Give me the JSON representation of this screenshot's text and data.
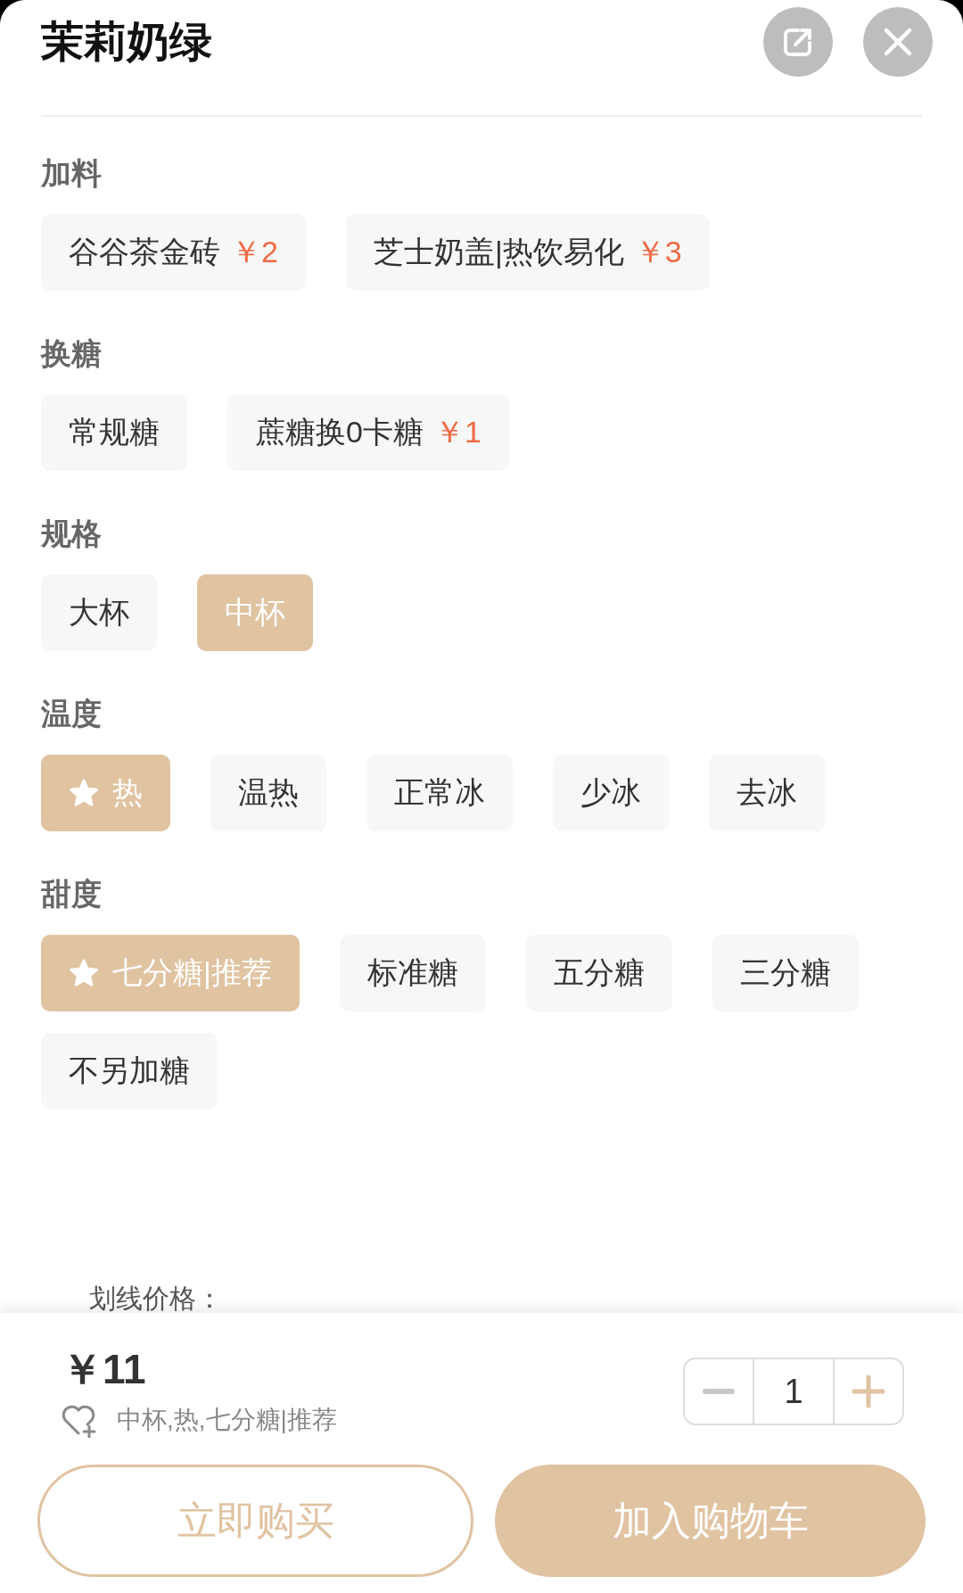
{
  "header": {
    "title": "茉莉奶绿"
  },
  "option_groups": [
    {
      "title": "加料",
      "options": [
        {
          "label": "谷谷茶金砖",
          "price": "￥2",
          "selected": false,
          "starred": false
        },
        {
          "label": "芝士奶盖|热饮易化",
          "price": "￥3",
          "selected": false,
          "starred": false
        }
      ]
    },
    {
      "title": "换糖",
      "options": [
        {
          "label": "常规糖",
          "selected": false,
          "starred": false
        },
        {
          "label": "蔗糖换0卡糖",
          "price": "￥1",
          "selected": false,
          "starred": false
        }
      ]
    },
    {
      "title": "规格",
      "options": [
        {
          "label": "大杯",
          "selected": false,
          "starred": false
        },
        {
          "label": "中杯",
          "selected": true,
          "starred": false
        }
      ]
    },
    {
      "title": "温度",
      "options": [
        {
          "label": "热",
          "selected": true,
          "starred": true
        },
        {
          "label": "温热",
          "selected": false,
          "starred": false
        },
        {
          "label": "正常冰",
          "selected": false,
          "starred": false
        },
        {
          "label": "少冰",
          "selected": false,
          "starred": false
        },
        {
          "label": "去冰",
          "selected": false,
          "starred": false
        }
      ]
    },
    {
      "title": "甜度",
      "options": [
        {
          "label": "七分糖|推荐",
          "selected": true,
          "starred": true
        },
        {
          "label": "标准糖",
          "selected": false,
          "starred": false
        },
        {
          "label": "五分糖",
          "selected": false,
          "starred": false
        },
        {
          "label": "三分糖",
          "selected": false,
          "starred": false
        },
        {
          "label": "不另加糖",
          "selected": false,
          "starred": false
        }
      ]
    }
  ],
  "list_price": {
    "label": "划线价格："
  },
  "footer": {
    "price": "￥11",
    "summary": "中杯,热,七分糖|推荐",
    "quantity": {
      "value": "1",
      "decrease_disabled": true
    },
    "buttons": [
      {
        "kind": "buy_now",
        "label": "立即购买"
      },
      {
        "kind": "add_to_cart",
        "label": "加入购物车"
      }
    ]
  }
}
